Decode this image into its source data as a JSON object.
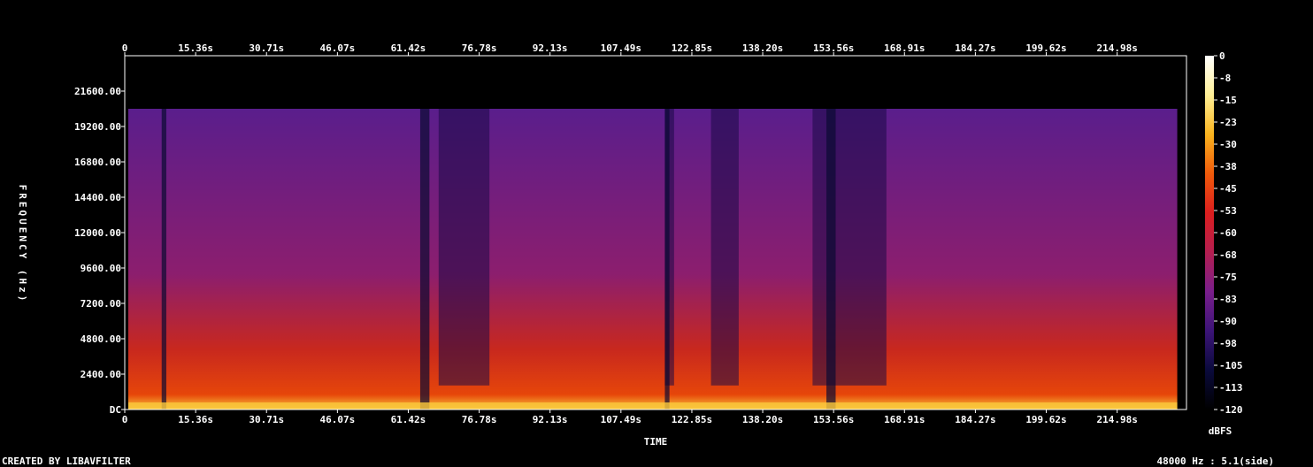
{
  "chart_data": {
    "type": "heatmap",
    "title": "",
    "xlabel": "TIME",
    "ylabel": "FREQUENCY (Hz)",
    "x_ticks": [
      "0",
      "15.36s",
      "30.71s",
      "46.07s",
      "61.42s",
      "76.78s",
      "92.13s",
      "107.49s",
      "122.85s",
      "138.20s",
      "153.56s",
      "168.91s",
      "184.27s",
      "199.62s",
      "214.98s"
    ],
    "x_tick_values": [
      0,
      15.36,
      30.71,
      46.07,
      61.42,
      76.78,
      92.13,
      107.49,
      122.85,
      138.2,
      153.56,
      168.91,
      184.27,
      199.62,
      214.98
    ],
    "y_ticks": [
      "DC",
      "2400.00",
      "4800.00",
      "7200.00",
      "9600.00",
      "12000.00",
      "14400.00",
      "16800.00",
      "19200.00",
      "21600.00"
    ],
    "y_tick_values": [
      0,
      2400,
      4800,
      7200,
      9600,
      12000,
      14400,
      16800,
      19200,
      21600
    ],
    "xlim": [
      0,
      230
    ],
    "ylim": [
      0,
      24000
    ],
    "colorbar": {
      "label": "dBFS",
      "ticks": [
        "0",
        "-8",
        "-15",
        "-23",
        "-30",
        "-38",
        "-45",
        "-53",
        "-60",
        "-68",
        "-75",
        "-83",
        "-90",
        "-98",
        "-105",
        "-113",
        "-120"
      ],
      "range": [
        -120,
        0
      ],
      "colors": [
        "#000000",
        "#0a0a3c",
        "#3c1478",
        "#7a1e8c",
        "#b41e50",
        "#dc1e1e",
        "#f05a0a",
        "#fab41e",
        "#fff096",
        "#ffffff"
      ]
    },
    "cutoff_hz": 20400,
    "end_time_s": 228,
    "quiet_segments_s": [
      [
        8,
        9
      ],
      [
        64,
        66
      ],
      [
        117,
        118
      ],
      [
        152,
        154
      ]
    ],
    "dark_band_segments_s": [
      [
        68,
        79
      ],
      [
        117,
        119
      ],
      [
        127,
        133
      ],
      [
        149,
        165
      ]
    ],
    "footer_left": "CREATED BY LIBAVFILTER",
    "footer_right": "48000 Hz : 5.1(side)"
  }
}
